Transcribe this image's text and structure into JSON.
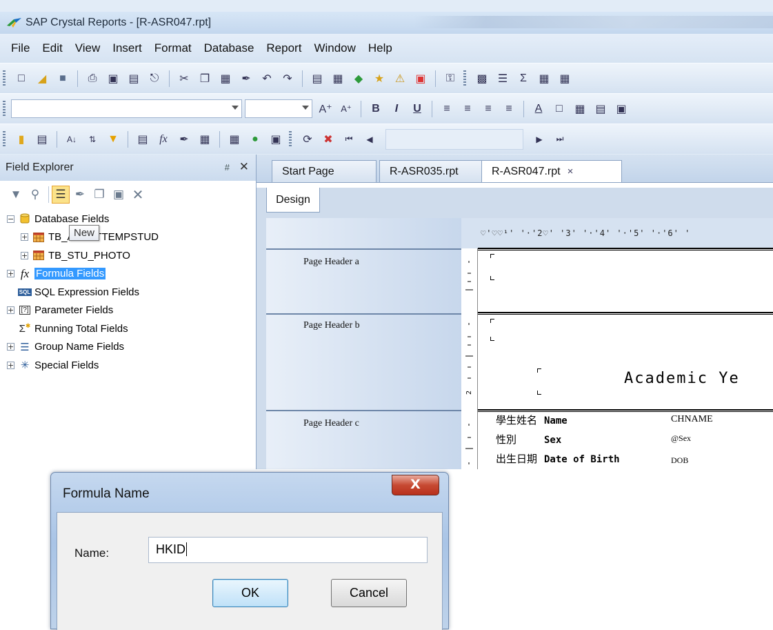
{
  "window": {
    "title": "SAP Crystal Reports - [R-ASR047.rpt]"
  },
  "menu": [
    "File",
    "Edit",
    "View",
    "Insert",
    "Format",
    "Database",
    "Report",
    "Window",
    "Help"
  ],
  "field_explorer": {
    "title": "Field Explorer",
    "pin_icon": "#",
    "close_icon": "✕",
    "tooltip": "New",
    "tree": [
      {
        "label": "Database Fields",
        "expander": "−",
        "icon": "database-icon",
        "depth": 0
      },
      {
        "label": "TB_ASRPTTEMPSTUD",
        "expander": "+",
        "icon": "table-icon",
        "depth": 1
      },
      {
        "label": "TB_STU_PHOTO",
        "expander": "+",
        "icon": "table-icon",
        "depth": 1
      },
      {
        "label": "Formula Fields",
        "expander": "+",
        "icon": "formula-icon",
        "depth": 0,
        "selected": true
      },
      {
        "label": "SQL Expression Fields",
        "expander": "",
        "icon": "sql-icon",
        "depth": 0
      },
      {
        "label": "Parameter Fields",
        "expander": "+",
        "icon": "parameter-icon",
        "depth": 0
      },
      {
        "label": "Running Total Fields",
        "expander": "",
        "icon": "running-total-icon",
        "depth": 0
      },
      {
        "label": "Group Name Fields",
        "expander": "+",
        "icon": "group-icon",
        "depth": 0
      },
      {
        "label": "Special Fields",
        "expander": "+",
        "icon": "special-icon",
        "depth": 0
      }
    ]
  },
  "tabs": [
    {
      "label": "Start Page"
    },
    {
      "label": "R-ASR035.rpt"
    },
    {
      "label": "R-ASR047.rpt",
      "close": "×",
      "active": true
    }
  ],
  "design_tab": "Design",
  "ruler_text": "♡'♡♡¹' '·'2♡' '3' '·'4' '·'5' '·'6' '",
  "sections": [
    "Page Header a",
    "Page Header b",
    "Page Header c"
  ],
  "report": {
    "academic": "Academic Ye",
    "rows": [
      {
        "cn": "學生姓名",
        "en": "Name",
        "field": "CHNAME"
      },
      {
        "cn": "性別",
        "en": "Sex",
        "field": "@Sex"
      },
      {
        "cn": "出生日期",
        "en": "Date of Birth",
        "field": "DOB"
      }
    ]
  },
  "dialog": {
    "title": "Formula Name",
    "close_label": "X",
    "name_label": "Name:",
    "name_value": "HKID",
    "ok": "OK",
    "cancel": "Cancel"
  },
  "colors": {
    "selection": "#3399ff",
    "chrome": "#d6e3f2",
    "close_red": "#c74a33"
  }
}
